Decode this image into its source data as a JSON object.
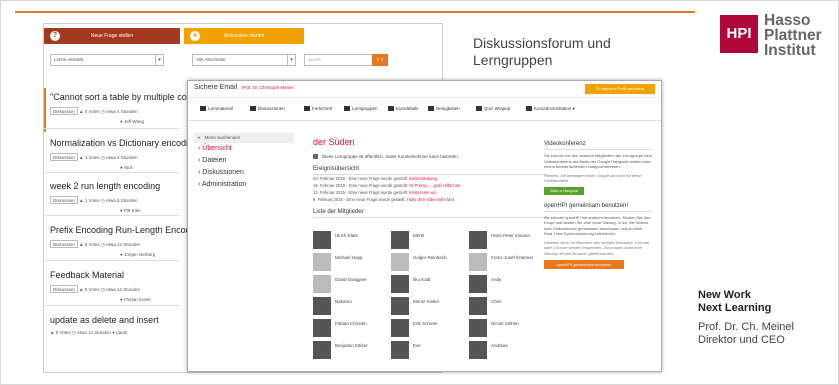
{
  "slide": {
    "title": "Diskussionsforum und Lerngruppen",
    "tagline_1": "New Work",
    "tagline_2": "Next Learning",
    "author": "Prof. Dr. Ch. Meinel",
    "role": "Direktor und CEO",
    "logo_box": "HPI",
    "logo_line_1": "Hasso",
    "logo_line_2": "Plattner",
    "logo_line_3": "Institut",
    "accent_color": "#e07a2f",
    "logo_color": "#b1063a"
  },
  "forum": {
    "new_question": "Neue Frage stellen",
    "new_discussion": "Diskussion starten",
    "filter_sort": "Letzte Aktivität",
    "filter_section": "Alle Abschnitte",
    "search_placeholder": "Suche",
    "search_btn": "» ×",
    "threads": [
      {
        "title": "\"Cannot sort a table by multiple columns at",
        "tag": "Diskussion",
        "votes": "0 Votes",
        "time": "etwa 4 Stunden",
        "author": "Jeff Wang"
      },
      {
        "title": "Normalization vs Dictionary encoding",
        "tag": "Diskussion",
        "votes": "1 Votes",
        "time": "etwa 4 Stunden",
        "author": "Nick"
      },
      {
        "title": "week 2 run length encoding",
        "tag": "Diskussion",
        "votes": "1 Votes",
        "time": "etwa 5 Stunden",
        "author": "Pitt Eike"
      },
      {
        "title": "Prefix Encoding Run-Length Encoding Clust",
        "tag": "Diskussion",
        "votes": "0 Votes",
        "time": "etwa 12 Stunden",
        "author": "Jürgen Nerberg"
      },
      {
        "title": "Feedback Material",
        "tag": "Diskussion",
        "votes": "0 Votes",
        "time": "etwa 12 Stunden",
        "author": "Florian Kunte"
      },
      {
        "title": "update   as delete and insert",
        "tag": "",
        "votes": "0 Votes",
        "time": "etwa 12 Stunden",
        "author": "paulrr"
      }
    ]
  },
  "group": {
    "email_label": "Sichere Email",
    "email_user": "Prof. Dr. Christoph Meinel",
    "profile_btn": "Zu meinem Profil wechseln",
    "nav": [
      "Lernmaterial",
      "Diskussionen",
      "Fortschritt",
      "Lerngruppen",
      "Kursdetails",
      "Neuigkeiten",
      "Quiz Wrapup",
      "Kursadministration ▾"
    ],
    "side_head": "Menü ausblenden",
    "side_links": [
      "› Übersicht",
      "› Dateien",
      "› Diskussionen",
      "› Administration"
    ],
    "title": "der Süden",
    "note": "Diese Lerngruppe ist öffentlich. Jeder Kursteilnehmer kann beitreten.",
    "events_title": "Ereignisübersicht",
    "events": [
      {
        "text": "23. Februar 2015 - Eine neue Frage wurde gestellt:",
        "link": "Einschränkung"
      },
      {
        "text": "16. Februar 2015 - Eine neue Frage wurde gestellt:",
        "link": "Ist Prinzip ... groß Hilfschen"
      },
      {
        "text": "14. Februar 2015 - Eine neue Frage wurde gestellt:",
        "link": "Kostet Hier ein"
      },
      {
        "text": "9. Februar 2015 - Eine neue Frage wurde gestellt:",
        "link": "Hallo (Ein Video sehr lan)"
      }
    ],
    "members_title": "Liste der Mitglieder",
    "members": [
      "Ulrich Klate",
      "Merkl",
      "Hans-Peter Klauser",
      "Michael Hopp",
      "Holger Reinbach",
      "Franz-Josef Kraemer",
      "David Gwiggner",
      "Ilko Kadt",
      "Andy",
      "Nakamu",
      "Moritz Kesler",
      "Chris",
      "Fabian Christen",
      "Erik Schrem",
      "Nicole Selhen",
      "Benjamin Kälzer",
      "Eve",
      "Andreas"
    ],
    "video_title": "Videokonferenz",
    "video_body": "Sie können mit den anderen Mitgliedern der Lerngruppe eine Videokonferenz auf Basis der Google Hangouts starten oder einem bereits laufenden Hangout beitreten.",
    "video_hint": "Hinweis: Sie benötigen einen Google Account für diese Funktionalität.",
    "video_btn": "Start a Hangout",
    "openhpi_title": "openHPI gemeinsam benutzen!",
    "openhpi_body": "Sie können openHPI mit anderen benutzen. Klicken Sie den Knopf und starten Sie eine neue Sitzung, in der Sie Videos oder Diskussionen gemeinsam anschauen und an einer Real-Time Synchronisierung teilnehmen.",
    "openhpi_hint": "Hinweis: Nicht für Benutzer des mobilen Browsers. Chrome oder Chrome werden empfohlen. Zuschauen kann eine Sitzung mit den Browser geteilt werden.",
    "openhpi_btn": "openHPI gemeinsam benutzen"
  }
}
